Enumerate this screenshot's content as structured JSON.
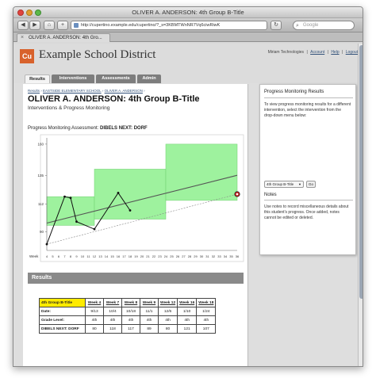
{
  "window": {
    "title": "OLIVER A. ANDERSON: 4th Group B-Title"
  },
  "toolbar": {
    "url": "http://cupertino.example.edu/cupertino/?_s=3KBMTWnNR7Vq6ciwRiwK",
    "search_placeholder": "Google"
  },
  "browser_tab": {
    "label": "OLIVER A. ANDERSON: 4th Gro..."
  },
  "header": {
    "logo": "Cu",
    "district": "Example School District",
    "user": "Miriam Technologies",
    "links": [
      "Account",
      "Help",
      "Logout"
    ]
  },
  "nav": {
    "tabs": [
      {
        "label": "Results",
        "active": true
      },
      {
        "label": "Interventions",
        "active": false
      },
      {
        "label": "Assessments",
        "active": false
      },
      {
        "label": "Admin",
        "active": false
      }
    ]
  },
  "main": {
    "breadcrumb": [
      "Results",
      "EASTSIDE ELEMENTARY SCHOOL",
      "OLIVER A. ANDERSON"
    ],
    "title": "OLIVER A. ANDERSON: 4th Group B-Title",
    "subtitle": "Interventions & Progress Monitoring",
    "assessment_label": "Progress Monitoring Assessment:",
    "assessment_name": "DIBELS NEXT: DORF",
    "results_heading": "Results"
  },
  "chart_data": {
    "type": "line",
    "x_label": "Week",
    "weeks": [
      4,
      5,
      6,
      7,
      8,
      9,
      10,
      11,
      12,
      13,
      14,
      15,
      16,
      17,
      18,
      19,
      20,
      21,
      22,
      23,
      24,
      25,
      26,
      27,
      28,
      29,
      30,
      31,
      32,
      33,
      34,
      35,
      36
    ],
    "yticks": [
      90,
      112,
      135,
      160
    ],
    "ylim": [
      75,
      165
    ],
    "series": [
      {
        "points": [
          [
            4,
            80
          ],
          [
            7,
            118
          ],
          [
            8,
            117
          ],
          [
            9,
            98
          ],
          [
            12,
            92
          ],
          [
            16,
            121
          ],
          [
            18,
            107
          ]
        ]
      }
    ],
    "goal_marker": [
      36,
      120
    ],
    "bands": [
      {
        "x": [
          4,
          12
        ],
        "y": [
          95,
          118
        ]
      },
      {
        "x": [
          12,
          24
        ],
        "y": [
          100,
          140
        ]
      },
      {
        "x": [
          24,
          36
        ],
        "y": [
          115,
          160
        ]
      }
    ],
    "colors": {
      "band": "#9ef29e",
      "data": "#111111",
      "trend": "#555555",
      "goal": "#cc2222"
    }
  },
  "results_table": {
    "group": "4th Group B-Title",
    "columns": [
      "Week 4",
      "Week 7",
      "Week 8",
      "Week 9",
      "Week 12",
      "Week 16",
      "Week 18"
    ],
    "rows": [
      {
        "label": "Date:",
        "values": [
          "9/13",
          "10/4",
          "10/18",
          "11/1",
          "12/6",
          "1/10",
          "1/24"
        ]
      },
      {
        "label": "Grade Level:",
        "values": [
          "4th",
          "4th",
          "4th",
          "4th",
          "4th",
          "4th",
          "4th"
        ]
      },
      {
        "label": "DIBELS NEXT: DORF",
        "values": [
          "80",
          "118",
          "117",
          "89",
          "80",
          "121",
          "107"
        ]
      }
    ]
  },
  "side": {
    "heading1": "Progress Monitoring Results",
    "text1": "To view progress monitoring results for a different intervention, select the intervention from the drop-down menu below:",
    "select_value": "4th Group B-Title",
    "go_label": "Go",
    "heading2": "Notes",
    "text2": "Use notes to record miscellaneous details about this student's progress. Once added, notes cannot be edited or deleted."
  }
}
